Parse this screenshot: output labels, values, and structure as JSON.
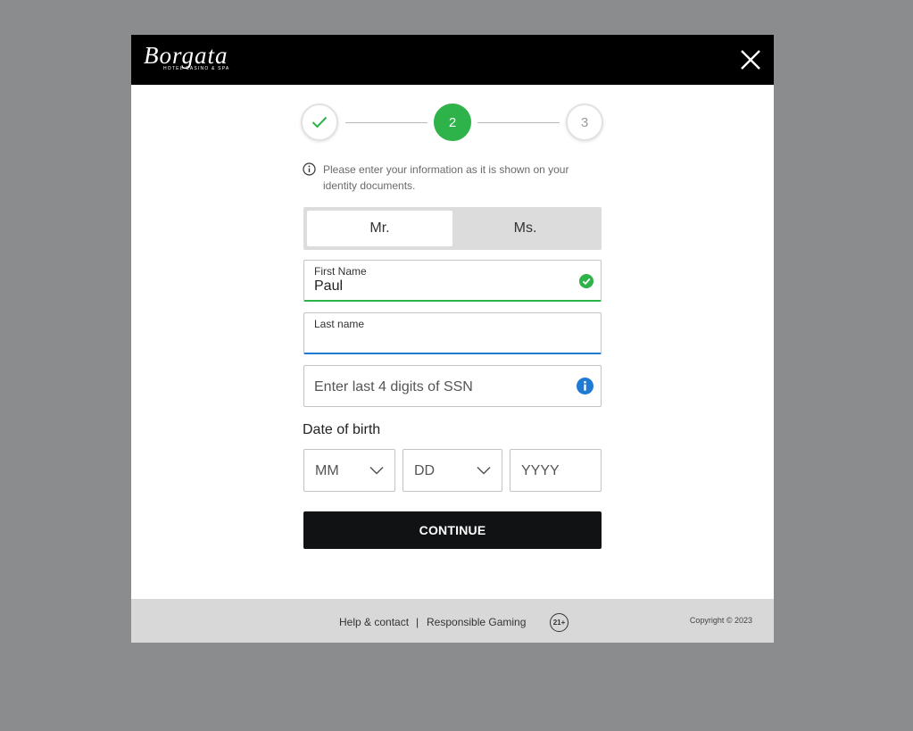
{
  "header": {
    "logo_text": "Borgata",
    "logo_sub": "HOTEL CASINO & SPA"
  },
  "stepper": {
    "steps": [
      {
        "label": "",
        "state": "done"
      },
      {
        "label": "2",
        "state": "active"
      },
      {
        "label": "3",
        "state": "pending"
      }
    ]
  },
  "info": {
    "text": "Please enter your information as it is shown on your identity documents."
  },
  "title_toggle": {
    "options": [
      "Mr.",
      "Ms."
    ],
    "selected": "Mr."
  },
  "fields": {
    "first_name": {
      "label": "First Name",
      "value": "Paul"
    },
    "last_name": {
      "label": "Last name",
      "value": ""
    },
    "ssn": {
      "placeholder": "Enter last 4 digits of SSN"
    }
  },
  "dob": {
    "label": "Date of birth",
    "month": "MM",
    "day": "DD",
    "year": "YYYY"
  },
  "continue_label": "CONTINUE",
  "footer": {
    "help": "Help & contact",
    "separator": "|",
    "responsible": "Responsible Gaming",
    "age": "21+",
    "copyright": "Copyright © 2023"
  },
  "colors": {
    "accent_green": "#2eb24a",
    "focus_blue": "#1e7ad2",
    "header_black": "#000000",
    "overlay_gray": "#8b8c8e"
  }
}
